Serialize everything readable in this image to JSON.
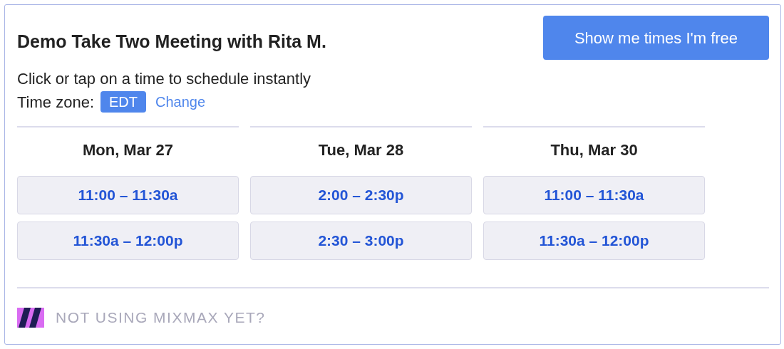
{
  "title": "Demo Take Two Meeting with Rita M.",
  "free_button": "Show me times I'm free",
  "instructions": "Click or tap on a time to schedule instantly",
  "time_zone": {
    "label": "Time zone:",
    "value": "EDT",
    "change_link": "Change"
  },
  "days": [
    {
      "date": "Mon, Mar 27",
      "slots": [
        "11:00 – 11:30a",
        "11:30a – 12:00p"
      ]
    },
    {
      "date": "Tue, Mar 28",
      "slots": [
        "2:00 – 2:30p",
        "2:30 – 3:00p"
      ]
    },
    {
      "date": "Thu, Mar 30",
      "slots": [
        "11:00 – 11:30a",
        "11:30a – 12:00p"
      ]
    }
  ],
  "footer": "NOT USING MIXMAX YET?"
}
